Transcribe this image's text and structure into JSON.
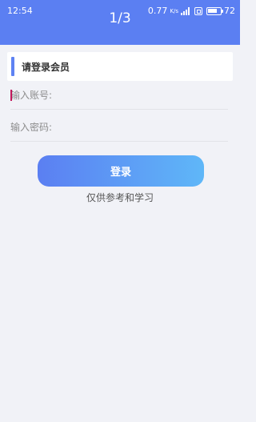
{
  "status_bar": {
    "time": "12:54",
    "speed": "0.77",
    "speed_unit": "K/s",
    "battery": "72",
    "icons": [
      "signal-icon",
      "sim-icon",
      "battery-icon"
    ]
  },
  "header": {
    "page_indicator": "1/3"
  },
  "login_card": {
    "title": "请登录会员"
  },
  "form": {
    "account_placeholder": "输入账号:",
    "password_placeholder": "输入密码:",
    "login_label": "登录"
  },
  "footnote": "仅供参考和学习",
  "colors": {
    "header": "#5b7ff2",
    "accent": "#5e82f3",
    "button_start": "#5b7ff2",
    "button_end": "#5fb7f8",
    "background": "#f1f2f7"
  }
}
